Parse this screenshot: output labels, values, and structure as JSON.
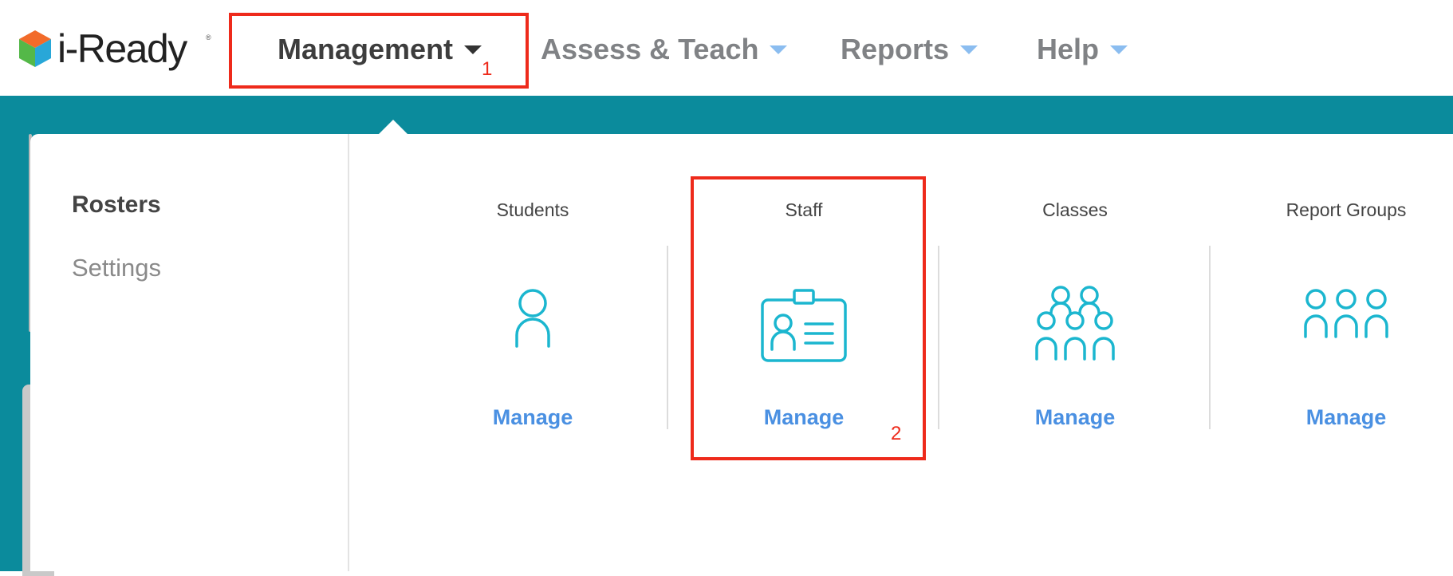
{
  "app": {
    "logo_text": "i-Ready",
    "logo_tm": "®"
  },
  "nav": {
    "items": [
      {
        "label": "Management",
        "active": true
      },
      {
        "label": "Assess & Teach",
        "active": false
      },
      {
        "label": "Reports",
        "active": false
      },
      {
        "label": "Help",
        "active": false
      }
    ]
  },
  "sidebar": {
    "items": [
      {
        "label": "Rosters",
        "selected": true
      },
      {
        "label": "Settings",
        "selected": false
      }
    ]
  },
  "cards": [
    {
      "title": "Students",
      "link": "Manage",
      "icon": "person-icon"
    },
    {
      "title": "Staff",
      "link": "Manage",
      "icon": "id-badge-icon"
    },
    {
      "title": "Classes",
      "link": "Manage",
      "icon": "group-icon"
    },
    {
      "title": "Report Groups",
      "link": "Manage",
      "icon": "people-row-icon"
    }
  ],
  "annotations": [
    {
      "number": "1"
    },
    {
      "number": "2"
    }
  ],
  "colors": {
    "teal_band": "#0b8b9c",
    "icon_cyan": "#1bb6cf",
    "link_blue": "#4a90e2",
    "annotation_red": "#ee2a1b",
    "nav_caret_idle": "#8bbdf0"
  }
}
